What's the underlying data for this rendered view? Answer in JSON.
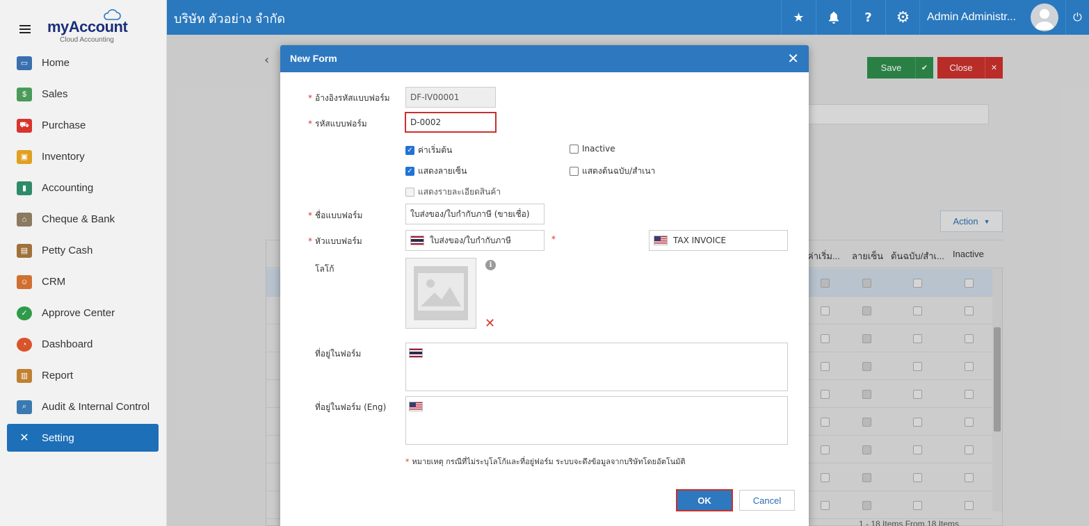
{
  "sidebar": {
    "brand": "myAccount",
    "brand_tagline": "Cloud Accounting",
    "items": [
      {
        "label": "Home",
        "icon": "home-icon",
        "color": "#3a6fb0"
      },
      {
        "label": "Sales",
        "icon": "sales-icon",
        "color": "#4a9a5a"
      },
      {
        "label": "Purchase",
        "icon": "cart-icon",
        "color": "#d9342b"
      },
      {
        "label": "Inventory",
        "icon": "box-icon",
        "color": "#e0a020"
      },
      {
        "label": "Accounting",
        "icon": "book-icon",
        "color": "#2e8b6a"
      },
      {
        "label": "Cheque & Bank",
        "icon": "bank-icon",
        "color": "#8a7a60"
      },
      {
        "label": "Petty Cash",
        "icon": "wallet-icon",
        "color": "#a0703a"
      },
      {
        "label": "CRM",
        "icon": "crm-icon",
        "color": "#d07030"
      },
      {
        "label": "Approve Center",
        "icon": "check-circle-icon",
        "color": "#2e9b4a"
      },
      {
        "label": "Dashboard",
        "icon": "pie-chart-icon",
        "color": "#d9542b"
      },
      {
        "label": "Report",
        "icon": "report-icon",
        "color": "#c08030"
      },
      {
        "label": "Audit & Internal Control",
        "icon": "magnifier-icon",
        "color": "#3a7ab0"
      },
      {
        "label": "Setting",
        "icon": "tools-icon",
        "color": "#ffffff"
      }
    ]
  },
  "header": {
    "company": "บริษัท ตัวอย่าง จำกัด",
    "user": "Admin Administr..."
  },
  "page": {
    "save_label": "Save",
    "close_label": "Close",
    "action_label": "Action",
    "grid_headers": [
      "ค่าเริ่ม...",
      "ลายเซ็น",
      "ต้นฉบับ/สำเ...",
      "Inactive"
    ],
    "footer_info": "1 - 18 Items From 18 Items"
  },
  "modal": {
    "title": "New Form",
    "ref_code_label": "อ้างอิงรหัสแบบฟอร์ม",
    "ref_code_value": "DF-IV00001",
    "form_code_label": "รหัสแบบฟอร์ม",
    "form_code_value": "D-0002",
    "checks": {
      "default": "ค่าเริ่มต้น",
      "inactive": "Inactive",
      "show_signature": "แสดงลายเซ็น",
      "show_original_copy": "แสดงต้นฉบับ/สำเนา",
      "show_product_detail": "แสดงรายละเอียดสินค้า"
    },
    "form_name_label": "ชื่อแบบฟอร์ม",
    "form_name_value": "ใบส่งของ/ใบกำกับภาษี (ขายเชื่อ)",
    "form_header_label": "หัวแบบฟอร์ม",
    "form_header_th": "ใบส่งของ/ใบกำกับภาษี",
    "form_header_en": "TAX INVOICE",
    "logo_label": "โลโก้",
    "address_label": "ที่อยู่ในฟอร์ม",
    "address_eng_label": "ที่อยู่ในฟอร์ม (Eng)",
    "note": "หมายเหตุ กรณีที่ไม่ระบุโลโก้และที่อยู่ฟอร์ม ระบบจะดึงข้อมูลจากบริษัทโดยอัตโนมัติ",
    "ok_label": "OK",
    "cancel_label": "Cancel"
  }
}
